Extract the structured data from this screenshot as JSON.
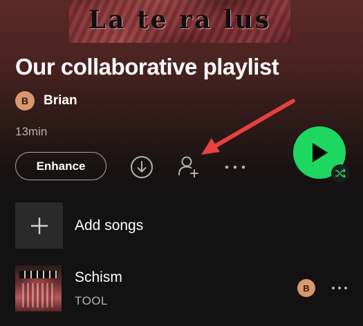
{
  "playlist": {
    "cover_text": "La te ra lus",
    "title": "Our collaborative playlist",
    "owner": {
      "initial": "B",
      "name": "Brian"
    },
    "duration": "13min"
  },
  "actions": {
    "enhance_label": "Enhance",
    "download_icon": "download-circle-icon",
    "add_collaborator_icon": "add-user-icon",
    "more_icon": "more-horizontal-icon",
    "play_icon": "play-icon",
    "shuffle_icon": "shuffle-icon"
  },
  "add_songs": {
    "label": "Add songs",
    "icon": "plus-icon"
  },
  "tracks": [
    {
      "title": "Schism",
      "artist": "TOOL",
      "added_by_initial": "B"
    }
  ],
  "colors": {
    "accent_green": "#1ed760",
    "background": "#121212",
    "header_gradient_top": "#5c2a26",
    "annotation_arrow": "#e8403f",
    "avatar": "#d9966f"
  }
}
